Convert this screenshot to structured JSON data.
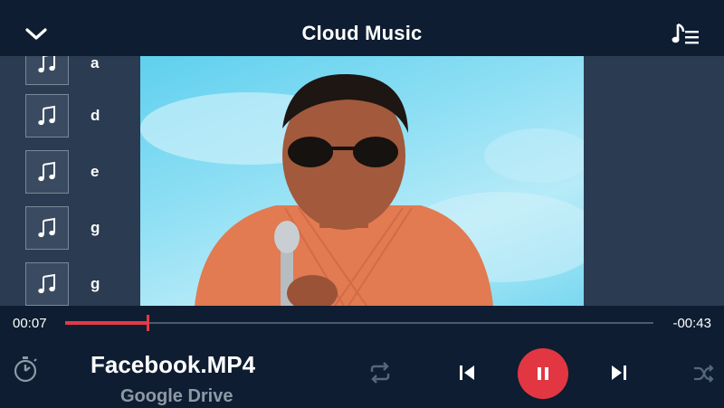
{
  "header": {
    "title": "Cloud Music",
    "back_icon": "chevron-down-icon",
    "playlist_icon": "music-list-icon"
  },
  "playlist": {
    "items": [
      {
        "label": "a",
        "icon": "music-note-icon"
      },
      {
        "label": "d",
        "icon": "music-note-icon"
      },
      {
        "label": "e",
        "icon": "music-note-icon"
      },
      {
        "label": "g",
        "icon": "music-note-icon"
      },
      {
        "label": "g",
        "icon": "music-note-icon"
      }
    ]
  },
  "player": {
    "elapsed": "00:07",
    "remaining": "-00:43",
    "progress_fraction": 0.14,
    "song_title": "Facebook.MP4",
    "source": "Google Drive",
    "accent_color": "#e23742"
  },
  "controls": {
    "timer_icon": "stopwatch-icon",
    "repeat_icon": "repeat-icon",
    "prev_icon": "skip-previous-icon",
    "pause_icon": "pause-icon",
    "next_icon": "skip-next-icon",
    "shuffle_icon": "shuffle-icon"
  }
}
